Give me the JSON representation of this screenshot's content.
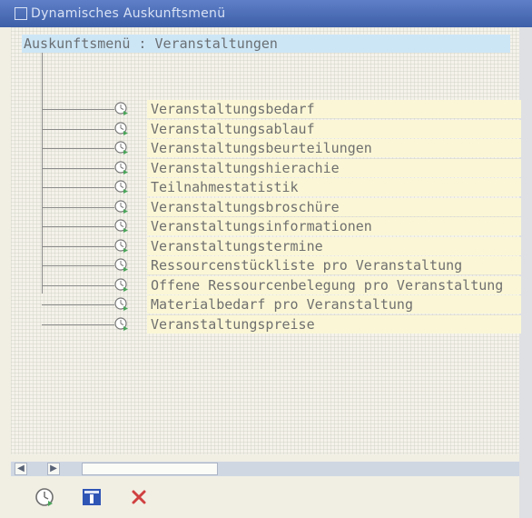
{
  "window": {
    "title": "Dynamisches Auskunftsmenü"
  },
  "tree": {
    "root_label": "Auskunftsmenü : Veranstaltungen",
    "items": [
      {
        "label": "Veranstaltungsbedarf"
      },
      {
        "label": "Veranstaltungsablauf"
      },
      {
        "label": "Veranstaltungsbeurteilungen"
      },
      {
        "label": "Veranstaltungshierachie"
      },
      {
        "label": "Teilnahmestatistik"
      },
      {
        "label": "Veranstaltungsbroschüre"
      },
      {
        "label": "Veranstaltungsinformationen"
      },
      {
        "label": "Veranstaltungstermine"
      },
      {
        "label": "Ressourcenstückliste pro Veranstaltung"
      },
      {
        "label": "Offene Ressourcenbelegung pro Veranstaltung"
      },
      {
        "label": "Materialbedarf pro Veranstaltung"
      },
      {
        "label": "Veranstaltungspreise"
      }
    ]
  },
  "scrollbar": {
    "left_arrow": "◀",
    "right_arrow": "▶"
  },
  "toolbar": {
    "buttons": [
      "execute-clock-icon",
      "info-icon",
      "cancel-icon"
    ]
  },
  "colors": {
    "titlebar": "#4a6bb5",
    "header_highlight": "#cde6f6",
    "row_highlight": "#fbf7d6",
    "cancel": "#d04040"
  }
}
